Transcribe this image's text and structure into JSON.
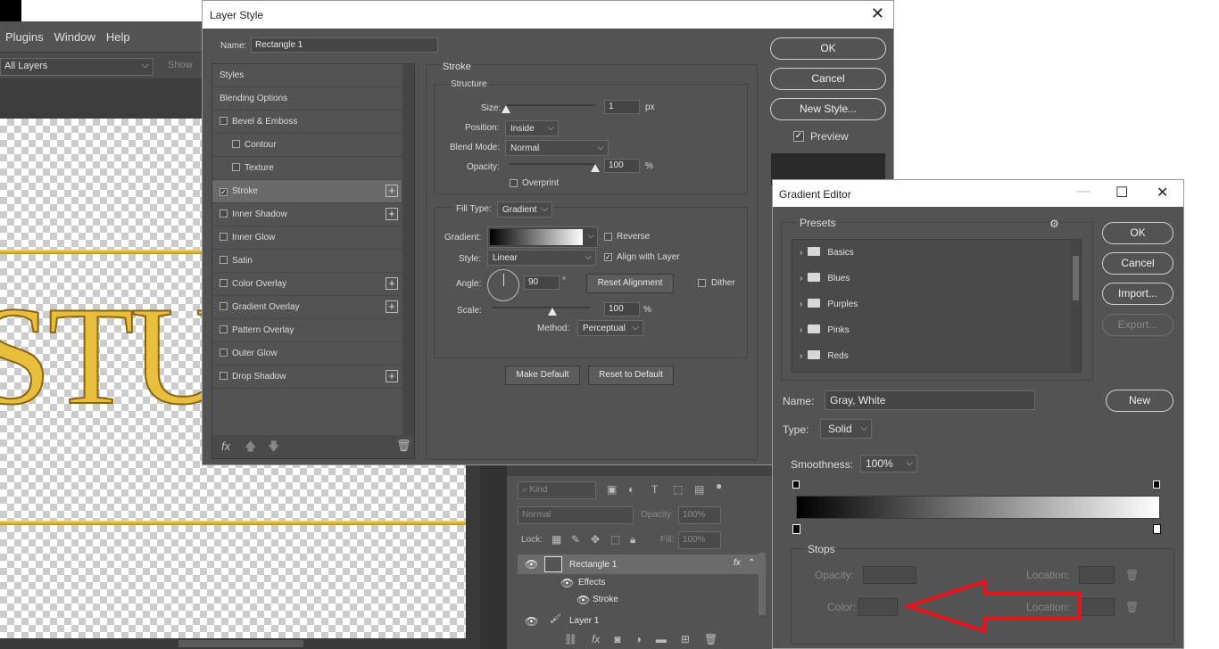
{
  "photoshop": {
    "menu": [
      "Plugins",
      "Window",
      "Help"
    ],
    "options_select": "All Layers",
    "options_show": "Show",
    "canvas_text": "STU",
    "layers_panel": {
      "kind_label": "Kind",
      "blend_mode": "Normal",
      "opacity_label": "Opacity:",
      "opacity_value": "100%",
      "lock_label": "Lock:",
      "fill_label": "Fill:",
      "fill_value": "100%",
      "layers": [
        {
          "name": "Rectangle 1",
          "badge": "fx"
        },
        {
          "name": "Effects"
        },
        {
          "name": "Stroke"
        },
        {
          "name": "Layer 1"
        }
      ]
    }
  },
  "layer_style": {
    "title": "Layer Style",
    "name_label": "Name:",
    "name_value": "Rectangle 1",
    "list": [
      {
        "label": "Styles",
        "checkbox": false,
        "plus": false,
        "indent": false
      },
      {
        "label": "Blending Options",
        "checkbox": false,
        "plus": false,
        "indent": false
      },
      {
        "label": "Bevel & Emboss",
        "checkbox": true,
        "checked": false,
        "plus": false,
        "indent": false
      },
      {
        "label": "Contour",
        "checkbox": true,
        "checked": false,
        "plus": false,
        "indent": true
      },
      {
        "label": "Texture",
        "checkbox": true,
        "checked": false,
        "plus": false,
        "indent": true
      },
      {
        "label": "Stroke",
        "checkbox": true,
        "checked": true,
        "plus": true,
        "indent": false,
        "selected": true
      },
      {
        "label": "Inner Shadow",
        "checkbox": true,
        "checked": false,
        "plus": true,
        "indent": false
      },
      {
        "label": "Inner Glow",
        "checkbox": true,
        "checked": false,
        "plus": false,
        "indent": false
      },
      {
        "label": "Satin",
        "checkbox": true,
        "checked": false,
        "plus": false,
        "indent": false
      },
      {
        "label": "Color Overlay",
        "checkbox": true,
        "checked": false,
        "plus": true,
        "indent": false
      },
      {
        "label": "Gradient Overlay",
        "checkbox": true,
        "checked": false,
        "plus": true,
        "indent": false
      },
      {
        "label": "Pattern Overlay",
        "checkbox": true,
        "checked": false,
        "plus": false,
        "indent": false
      },
      {
        "label": "Outer Glow",
        "checkbox": true,
        "checked": false,
        "plus": false,
        "indent": false
      },
      {
        "label": "Drop Shadow",
        "checkbox": true,
        "checked": false,
        "plus": true,
        "indent": false
      }
    ],
    "fx_label": "fx",
    "stroke": {
      "group_title": "Stroke",
      "structure_title": "Structure",
      "size_label": "Size:",
      "size_value": "1",
      "size_unit": "px",
      "size_level": 0.0,
      "position_label": "Position:",
      "position_value": "Inside",
      "blend_label": "Blend Mode:",
      "blend_value": "Normal",
      "opacity_label": "Opacity:",
      "opacity_value": "100",
      "opacity_unit": "%",
      "opacity_level": 1.0,
      "overprint_label": "Overprint",
      "filltype_label": "Fill Type:",
      "filltype_value": "Gradient",
      "gradient_label": "Gradient:",
      "reverse_label": "Reverse",
      "style_label": "Style:",
      "style_value": "Linear",
      "align_label": "Align with Layer",
      "angle_label": "Angle:",
      "angle_value": "90",
      "angle_unit": "°",
      "reset_alignment": "Reset Alignment",
      "dither_label": "Dither",
      "scale_label": "Scale:",
      "scale_value": "100",
      "scale_unit": "%",
      "method_label": "Method:",
      "method_value": "Perceptual",
      "make_default": "Make Default",
      "reset_default": "Reset to Default"
    },
    "buttons": {
      "ok": "OK",
      "cancel": "Cancel",
      "new_style": "New Style...",
      "preview": "Preview"
    }
  },
  "gradient_editor": {
    "title": "Gradient Editor",
    "presets_label": "Presets",
    "presets": [
      "Basics",
      "Blues",
      "Purples",
      "Pinks",
      "Reds"
    ],
    "buttons": {
      "ok": "OK",
      "cancel": "Cancel",
      "import": "Import...",
      "export": "Export...",
      "new": "New"
    },
    "name_label": "Name:",
    "name_value": "Gray, White",
    "type_label": "Type:",
    "type_value": "Solid",
    "smoothness_label": "Smoothness:",
    "smoothness_value": "100%",
    "stops_title": "Stops",
    "opacity_label": "Opacity:",
    "location_label": "Location:",
    "color_label": "Color:",
    "gradient_start_color": "#000000",
    "gradient_end_color": "#ffffff"
  },
  "colors": {
    "panel": "#535353",
    "annotation_arrow": "#e8131b"
  }
}
